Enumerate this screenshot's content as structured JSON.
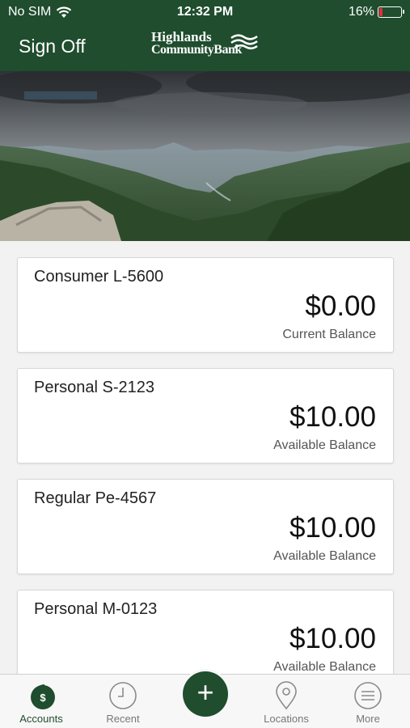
{
  "status_bar": {
    "carrier": "No SIM",
    "time": "12:32 PM",
    "battery_percent": "16%",
    "battery_level": 0.16,
    "battery_color": "#e0323a"
  },
  "header": {
    "sign_off_label": "Sign Off",
    "logo_line1": "Highlands",
    "logo_line2": "CommunityBank",
    "brand_color": "#1f4d2e"
  },
  "accounts": [
    {
      "name": "Consumer L-5600",
      "amount": "$0.00",
      "balance_label": "Current Balance"
    },
    {
      "name": "Personal S-2123",
      "amount": "$10.00",
      "balance_label": "Available Balance"
    },
    {
      "name": "Regular Pe-4567",
      "amount": "$10.00",
      "balance_label": "Available Balance"
    },
    {
      "name": "Personal M-0123",
      "amount": "$10.00",
      "balance_label": "Available Balance"
    }
  ],
  "tab_bar": {
    "tabs": [
      {
        "label": "Accounts",
        "icon": "dollar-icon"
      },
      {
        "label": "Recent",
        "icon": "clock-icon"
      },
      {
        "label": "Locations",
        "icon": "map-pin-icon"
      },
      {
        "label": "More",
        "icon": "menu-icon"
      }
    ],
    "add_label": "+"
  }
}
